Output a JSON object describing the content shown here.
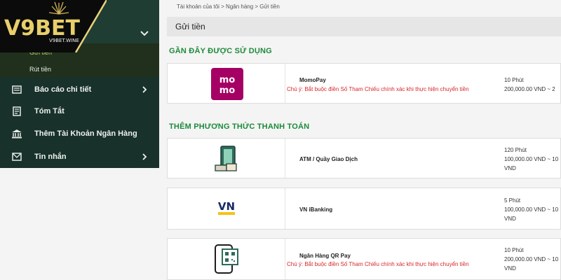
{
  "brand": {
    "logo_text": "V9BET",
    "logo_sub": "V9BET.WINE"
  },
  "sidebar": {
    "sub_items": [
      {
        "label": "Gửi tiền"
      },
      {
        "label": "Rút tiền"
      }
    ],
    "items": [
      {
        "label": "Báo cáo chi tiết",
        "icon": "report-icon"
      },
      {
        "label": "Tóm Tắt",
        "icon": "summary-icon"
      },
      {
        "label": "Thêm Tài Khoản Ngân Hàng",
        "icon": "bank-icon"
      },
      {
        "label": "Tin nhắn",
        "icon": "mail-icon"
      }
    ]
  },
  "breadcrumb": "Tài khoản của tôi > Ngân hàng > Gửi tiền",
  "page_title": "Gửi tiền",
  "sections": {
    "recent": "GẦN ĐÂY ĐƯỢC SỬ DỤNG",
    "more": "THÊM PHƯƠNG THỨC THANH TOÁN"
  },
  "methods": [
    {
      "name": "MomoPay",
      "note": "Chú ý: Bắt buộc điền Số Tham Chiếu chính xác khi thực hiện chuyển tiền",
      "time": "10 Phút",
      "range": "200,000.00 VND ~ 2",
      "unit": "",
      "icon": "momo-logo",
      "icon_text": "mo mo"
    },
    {
      "name": "ATM / Quầy Giao Dịch",
      "note": "",
      "time": "120 Phút",
      "range": "100,000.00 VND ~ 10",
      "unit": "VND",
      "icon": "atm-cash-icon"
    },
    {
      "name": "VN iBanking",
      "note": "",
      "time": "5 Phút",
      "range": "100,000.00 VND ~ 10",
      "unit": "VND",
      "icon": "vn-ibanking-logo",
      "icon_text": "VN"
    },
    {
      "name": "Ngân Hàng QR Pay",
      "note": "Chú ý: Bắt buộc điền Số Tham Chiếu chính xác khi thực hiện chuyển tiền",
      "time": "10 Phút",
      "range": "200,000.00 VND ~ 10",
      "unit": "VND",
      "icon": "qr-phone-icon"
    }
  ],
  "colors": {
    "sidebar_bg": "#18312a",
    "accent_green": "#1c8a3a",
    "warning_red": "#d8262a",
    "momo_pink": "#a50064",
    "vn_yellow": "#f3c316"
  }
}
